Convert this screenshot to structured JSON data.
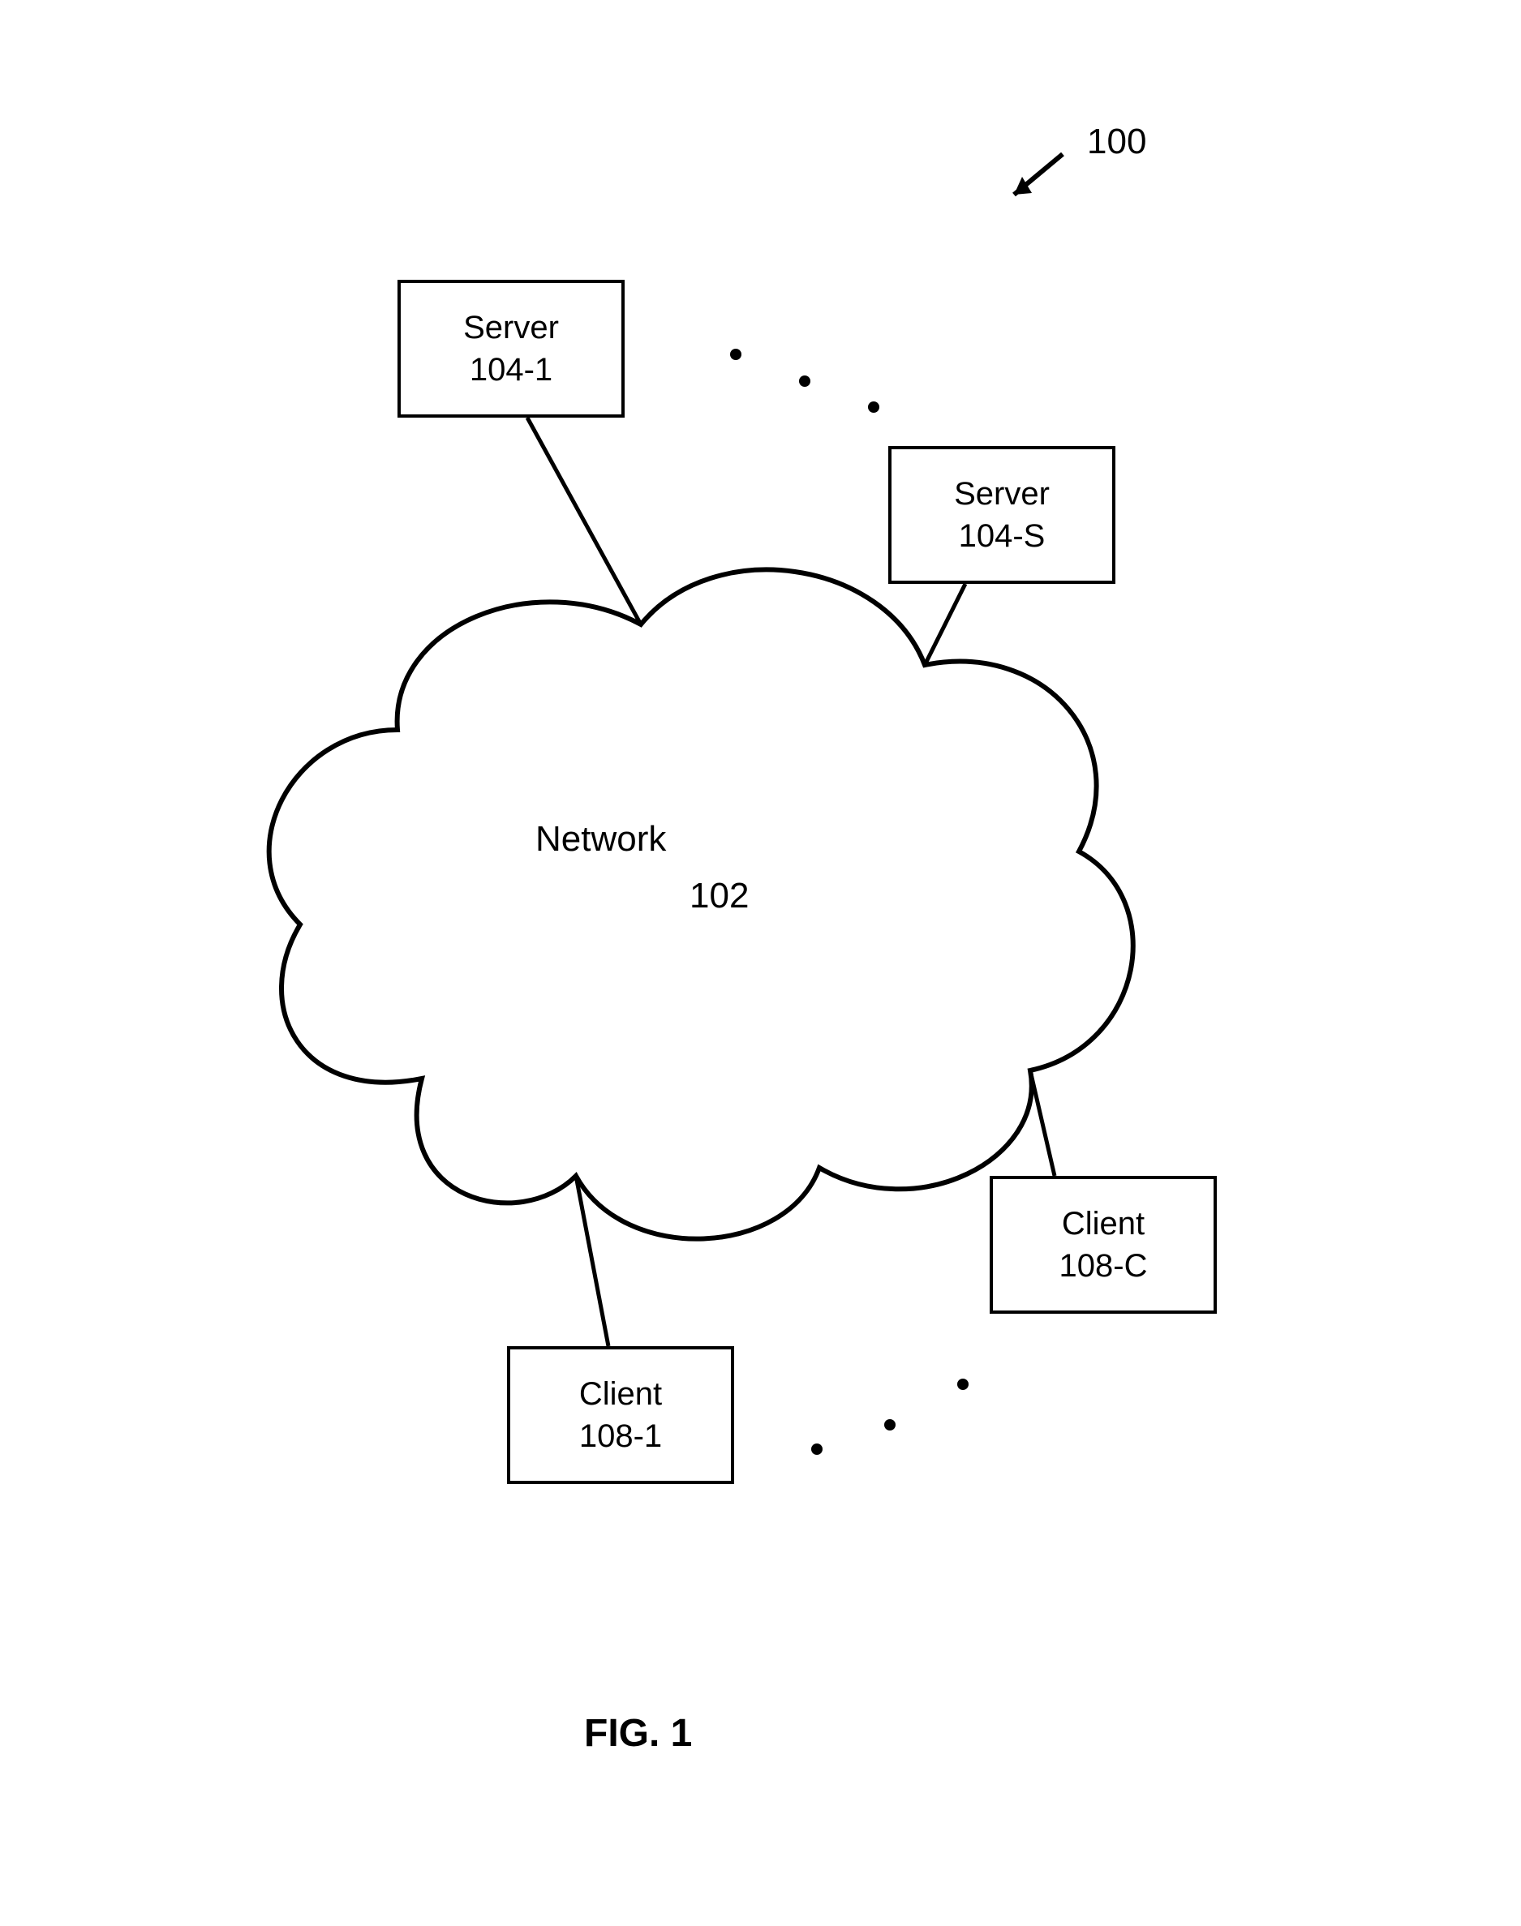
{
  "figure": {
    "ref_number": "100",
    "caption": "FIG. 1"
  },
  "nodes": {
    "server1": {
      "title": "Server",
      "ref": "104-1"
    },
    "serverS": {
      "title": "Server",
      "ref": "104-S"
    },
    "client1": {
      "title": "Client",
      "ref": "108-1"
    },
    "clientC": {
      "title": "Client",
      "ref": "108-C"
    },
    "network": {
      "title": "Network",
      "ref": "102"
    }
  }
}
